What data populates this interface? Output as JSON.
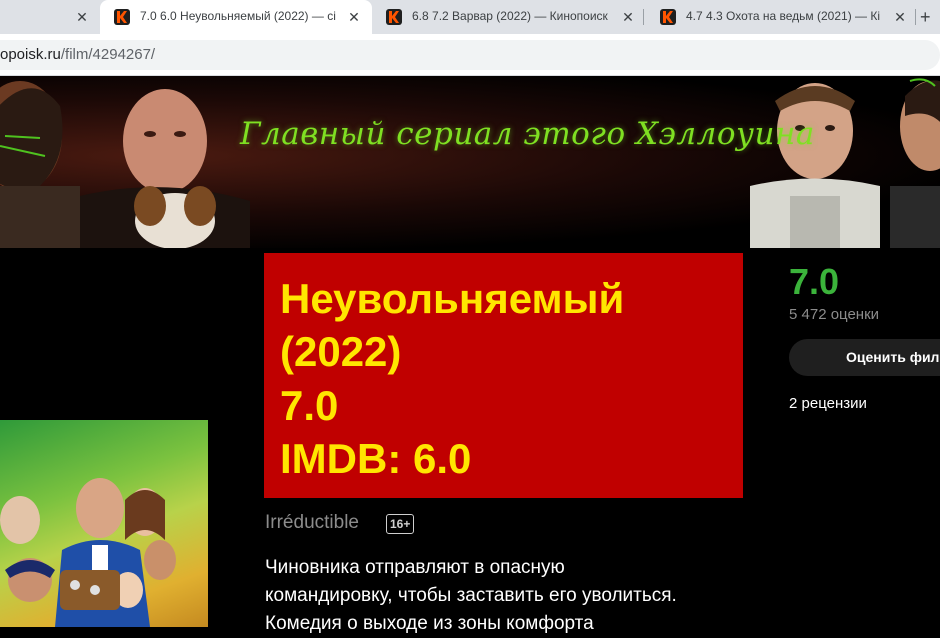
{
  "browser": {
    "tabs": [
      {
        "title": "7.0 6.0 Неувольняемый (2022) — сі",
        "active": true
      },
      {
        "title": "6.8 7.2 Варвар (2022) — Кинопоиск",
        "active": false
      },
      {
        "title": "4.7 4.3 Охота на ведьм (2021) — Кі",
        "active": false
      }
    ],
    "close_glyph": "✕",
    "new_tab_glyph": "+",
    "url_host": "opoisk.ru",
    "url_path": "/film/4294267/"
  },
  "banner": {
    "tagline": "Главный сериал этого Хэллоуина"
  },
  "film": {
    "overlay_lines": [
      "Неувольняемый",
      "(2022)",
      "7.0",
      "IMDB: 6.0"
    ],
    "original_title": "Irréductible",
    "age_rating": "16+",
    "description_lines": [
      "Чиновника отправляют в опасную",
      "командировку, чтобы заставить его уволиться.",
      "Комедия о выходе из зоны комфорта"
    ]
  },
  "rating_panel": {
    "rating": "7.0",
    "votes": "5 472 оценки",
    "rate_button": "Оценить фильм",
    "reviews": "2 рецензии"
  },
  "colors": {
    "accent_green": "#3bb33b",
    "overlay_red": "#c00000",
    "overlay_text": "#ffe600",
    "tagline_green": "#7fe022"
  }
}
